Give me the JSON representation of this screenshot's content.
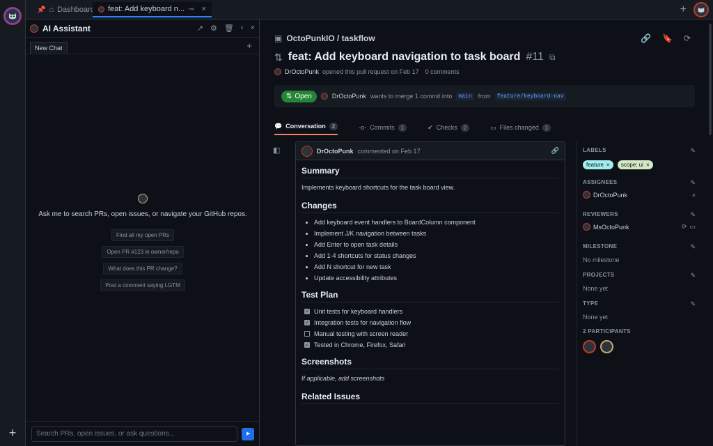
{
  "tabs": [
    {
      "label": "Dashboard"
    },
    {
      "label": "feat: Add keyboard n..."
    }
  ],
  "ai": {
    "title": "AI Assistant",
    "chat_tab": "New Chat",
    "empty_message": "Ask me to search PRs, open issues, or navigate your GitHub repos.",
    "suggestions": [
      "Find all my open PRs",
      "Open PR #123 in owner/repo",
      "What does this PR change?",
      "Post a comment saying LGTM"
    ],
    "input_placeholder": "Search PRs, open issues, or ask questions..."
  },
  "repo": {
    "name": "OctoPunkIO / taskflow"
  },
  "pr": {
    "title": "feat: Add keyboard navigation to task board",
    "number": "#11",
    "author": "DrOctoPunk",
    "meta_text": "opened this pull request on Feb 17",
    "comments": "0 comments",
    "status": "Open",
    "merge_text": "wants to merge 1 commit into",
    "base": "main",
    "from": "from",
    "head": "feature/keyboard-nav"
  },
  "pr_tabs": [
    {
      "label": "Conversation",
      "count": "2"
    },
    {
      "label": "Commits",
      "count": "1"
    },
    {
      "label": "Checks",
      "count": "2"
    },
    {
      "label": "Files changed",
      "count": "1"
    }
  ],
  "comment": {
    "author": "DrOctoPunk",
    "when": "commented on Feb 17",
    "summary_heading": "Summary",
    "summary": "Implements keyboard shortcuts for the task board view.",
    "changes_heading": "Changes",
    "changes": [
      "Add keyboard event handlers to BoardColumn component",
      "Implement J/K navigation between tasks",
      "Add Enter to open task details",
      "Add 1-4 shortcuts for status changes",
      "Add N shortcut for new task",
      "Update accessibility attributes"
    ],
    "test_heading": "Test Plan",
    "tests": [
      {
        "text": "Unit tests for keyboard handlers",
        "checked": true
      },
      {
        "text": "Integration tests for navigation flow",
        "checked": true
      },
      {
        "text": "Manual testing with screen reader",
        "checked": false
      },
      {
        "text": "Tested in Chrome, Firefox, Safari",
        "checked": true
      }
    ],
    "screenshots_heading": "Screenshots",
    "screenshots_text": "If applicable, add screenshots",
    "related_heading": "Related Issues"
  },
  "sidebar": {
    "labels_title": "Labels",
    "labels": [
      "feature",
      "scope: ui"
    ],
    "assignees_title": "Assignees",
    "assignee": "DrOctoPunk",
    "reviewers_title": "Reviewers",
    "reviewer": "MsOctoPunk",
    "milestone_title": "Milestone",
    "milestone": "No milestone",
    "projects_title": "Projects",
    "projects": "None yet",
    "type_title": "Type",
    "type": "None yet",
    "participants_title": "2 Participants"
  },
  "colors": {
    "accent": "#2f81f7",
    "open": "#238636",
    "tab_underline": "#f78166"
  }
}
